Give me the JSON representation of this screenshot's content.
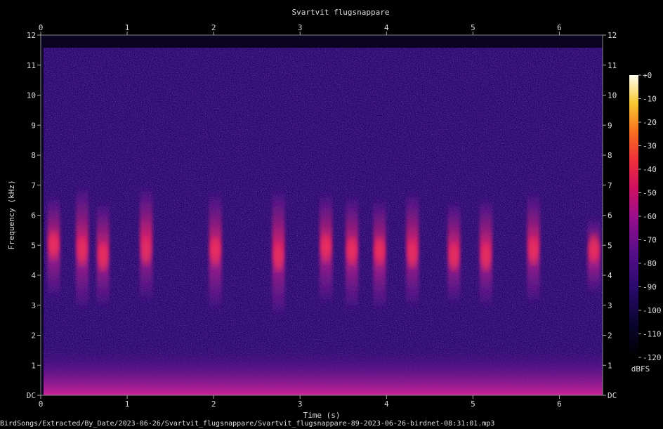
{
  "chart_data": {
    "type": "heatmap",
    "title": "Svartvit flugsnappare",
    "xlabel": "Time (s)",
    "ylabel": "Frequency (kHz)",
    "xlim": [
      0,
      6.5
    ],
    "ylim": [
      0,
      12
    ],
    "x_ticks": [
      "0",
      "1",
      "2",
      "3",
      "4",
      "5",
      "6"
    ],
    "y_ticks": [
      "DC",
      "1",
      "2",
      "3",
      "4",
      "5",
      "6",
      "7",
      "8",
      "9",
      "10",
      "11",
      "12"
    ],
    "colorbar": {
      "label": "dBFS",
      "range": [
        -120,
        0
      ],
      "ticks": [
        "+0",
        "-10",
        "-20",
        "-30",
        "-40",
        "-50",
        "-60",
        "-70",
        "-80",
        "-90",
        "-100",
        "-110",
        "-120"
      ]
    },
    "calls": [
      {
        "t": 0.15,
        "f_low": 3.4,
        "f_high": 6.5,
        "peak": 5.0
      },
      {
        "t": 0.48,
        "f_low": 3.0,
        "f_high": 6.8,
        "peak": 4.8
      },
      {
        "t": 0.72,
        "f_low": 3.1,
        "f_high": 6.3,
        "peak": 4.6
      },
      {
        "t": 1.22,
        "f_low": 3.3,
        "f_high": 6.8,
        "peak": 4.8
      },
      {
        "t": 2.02,
        "f_low": 3.0,
        "f_high": 6.6,
        "peak": 4.8
      },
      {
        "t": 2.75,
        "f_low": 2.8,
        "f_high": 6.7,
        "peak": 4.6
      },
      {
        "t": 3.3,
        "f_low": 3.2,
        "f_high": 6.6,
        "peak": 4.9
      },
      {
        "t": 3.6,
        "f_low": 3.0,
        "f_high": 6.5,
        "peak": 4.8
      },
      {
        "t": 3.92,
        "f_low": 3.0,
        "f_high": 6.4,
        "peak": 4.8
      },
      {
        "t": 4.3,
        "f_low": 3.1,
        "f_high": 6.6,
        "peak": 4.7
      },
      {
        "t": 4.78,
        "f_low": 3.2,
        "f_high": 6.3,
        "peak": 4.6
      },
      {
        "t": 5.15,
        "f_low": 3.1,
        "f_high": 6.4,
        "peak": 4.6
      },
      {
        "t": 5.7,
        "f_low": 3.2,
        "f_high": 6.6,
        "peak": 4.8
      },
      {
        "t": 6.4,
        "f_low": 3.5,
        "f_high": 5.8,
        "peak": 4.9
      }
    ],
    "source": "BirdSongs/Extracted/By_Date/2023-06-26/Svartvit_flugsnappare/Svartvit_flugsnappare-89-2023-06-26-birdnet-08:31:01.mp3"
  }
}
